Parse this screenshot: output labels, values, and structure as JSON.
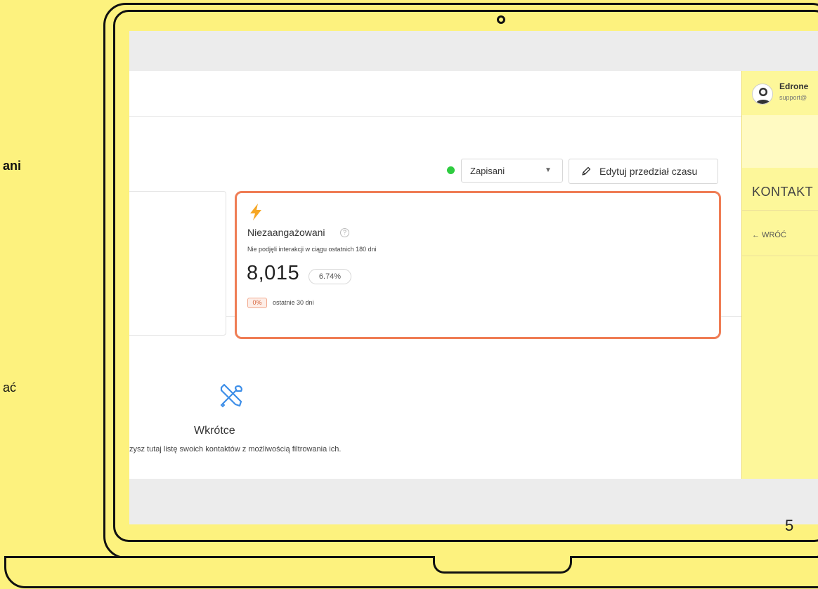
{
  "slide": {
    "side_text_bold": "ani",
    "side_text": "ać",
    "page_number": "5"
  },
  "toolbar": {
    "segment_select_value": "Zapisani",
    "edit_button_label": "Edytuj przedział czasu",
    "status_color": "#2ecc40"
  },
  "card": {
    "icon": "bolt-icon",
    "title": "Niezaangażowani",
    "subtitle": "Nie podjęli interakcji w ciągu ostatnich 180 dni",
    "value": "8,015",
    "percent": "6.74%",
    "change": "0%",
    "change_label": "ostatnie 30 dni",
    "highlight_color": "#ef7d55"
  },
  "coming_soon": {
    "icon": "tools-icon",
    "title": "Wkrótce",
    "description": "zysz tutaj listę swoich kontaktów z możliwością filtrowania ich."
  },
  "right_panel": {
    "user_name": "Edrone",
    "user_email": "support@",
    "contacts_title": "KONTAKT",
    "back_label": "← WRÓĆ"
  }
}
